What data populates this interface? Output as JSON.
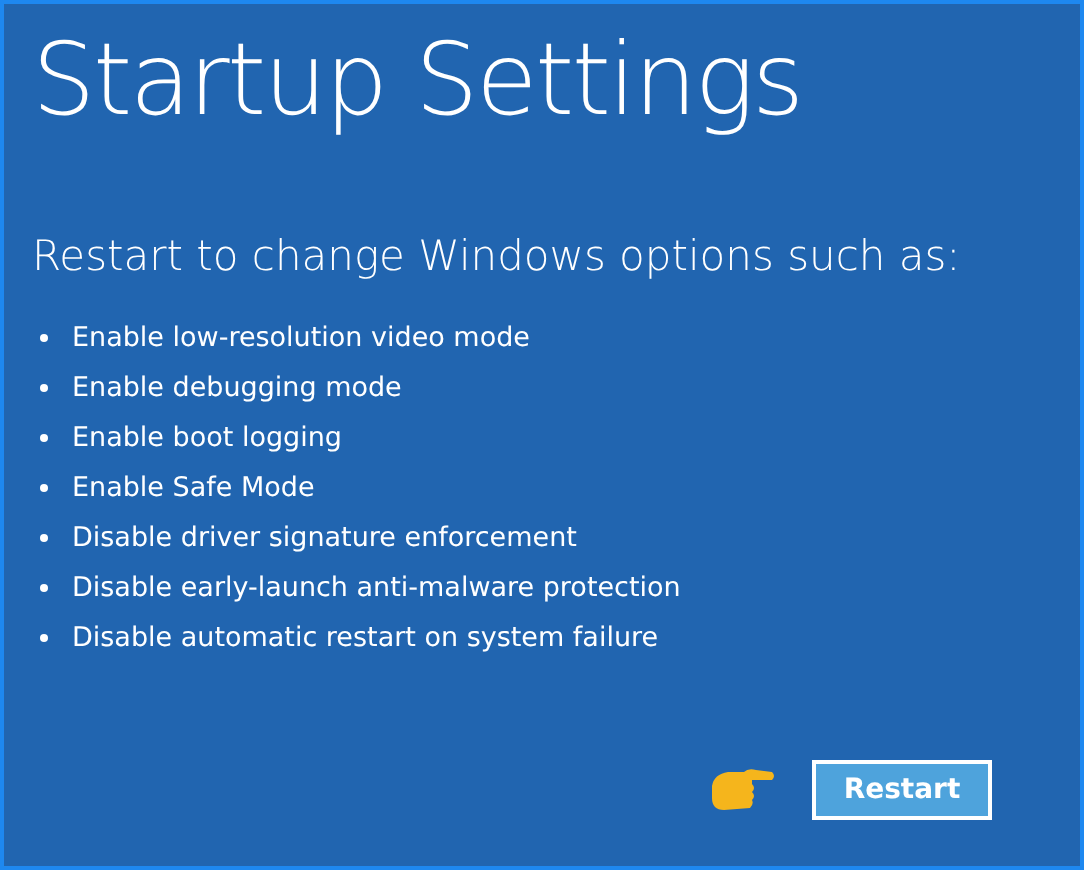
{
  "title": "Startup Settings",
  "subtitle": "Restart to change Windows options such as:",
  "options": [
    "Enable low-resolution video mode",
    "Enable debugging mode",
    "Enable boot logging",
    "Enable Safe Mode",
    "Disable driver signature enforcement",
    "Disable early-launch anti-malware protection",
    "Disable automatic restart on system failure"
  ],
  "button": "Restart"
}
